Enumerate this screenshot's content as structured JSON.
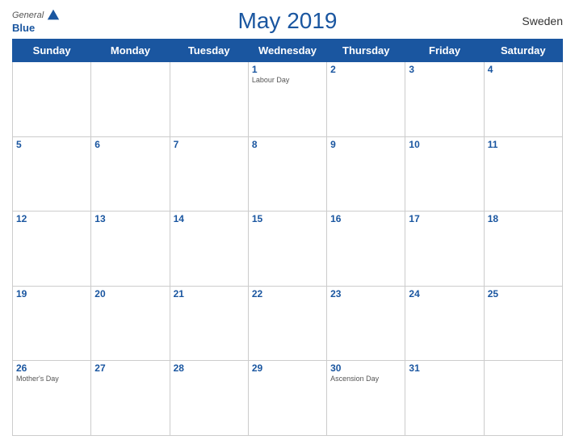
{
  "header": {
    "title": "May 2019",
    "country": "Sweden",
    "logo_general": "General",
    "logo_blue": "Blue"
  },
  "weekdays": [
    "Sunday",
    "Monday",
    "Tuesday",
    "Wednesday",
    "Thursday",
    "Friday",
    "Saturday"
  ],
  "weeks": [
    [
      {
        "day": "",
        "holiday": ""
      },
      {
        "day": "",
        "holiday": ""
      },
      {
        "day": "",
        "holiday": ""
      },
      {
        "day": "1",
        "holiday": "Labour Day"
      },
      {
        "day": "2",
        "holiday": ""
      },
      {
        "day": "3",
        "holiday": ""
      },
      {
        "day": "4",
        "holiday": ""
      }
    ],
    [
      {
        "day": "5",
        "holiday": ""
      },
      {
        "day": "6",
        "holiday": ""
      },
      {
        "day": "7",
        "holiday": ""
      },
      {
        "day": "8",
        "holiday": ""
      },
      {
        "day": "9",
        "holiday": ""
      },
      {
        "day": "10",
        "holiday": ""
      },
      {
        "day": "11",
        "holiday": ""
      }
    ],
    [
      {
        "day": "12",
        "holiday": ""
      },
      {
        "day": "13",
        "holiday": ""
      },
      {
        "day": "14",
        "holiday": ""
      },
      {
        "day": "15",
        "holiday": ""
      },
      {
        "day": "16",
        "holiday": ""
      },
      {
        "day": "17",
        "holiday": ""
      },
      {
        "day": "18",
        "holiday": ""
      }
    ],
    [
      {
        "day": "19",
        "holiday": ""
      },
      {
        "day": "20",
        "holiday": ""
      },
      {
        "day": "21",
        "holiday": ""
      },
      {
        "day": "22",
        "holiday": ""
      },
      {
        "day": "23",
        "holiday": ""
      },
      {
        "day": "24",
        "holiday": ""
      },
      {
        "day": "25",
        "holiday": ""
      }
    ],
    [
      {
        "day": "26",
        "holiday": "Mother's Day"
      },
      {
        "day": "27",
        "holiday": ""
      },
      {
        "day": "28",
        "holiday": ""
      },
      {
        "day": "29",
        "holiday": ""
      },
      {
        "day": "30",
        "holiday": "Ascension Day"
      },
      {
        "day": "31",
        "holiday": ""
      },
      {
        "day": "",
        "holiday": ""
      }
    ]
  ]
}
